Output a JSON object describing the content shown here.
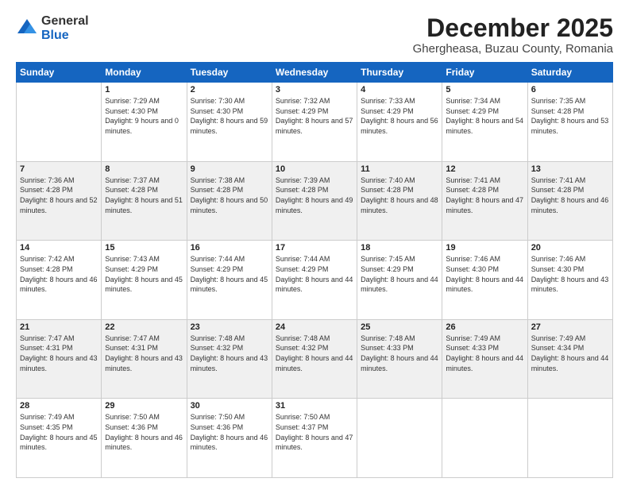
{
  "logo": {
    "general": "General",
    "blue": "Blue"
  },
  "title": "December 2025",
  "location": "Ghergheasa, Buzau County, Romania",
  "days_of_week": [
    "Sunday",
    "Monday",
    "Tuesday",
    "Wednesday",
    "Thursday",
    "Friday",
    "Saturday"
  ],
  "weeks": [
    [
      {
        "day": "",
        "sunrise": "",
        "sunset": "",
        "daylight": ""
      },
      {
        "day": "1",
        "sunrise": "Sunrise: 7:29 AM",
        "sunset": "Sunset: 4:30 PM",
        "daylight": "Daylight: 9 hours and 0 minutes."
      },
      {
        "day": "2",
        "sunrise": "Sunrise: 7:30 AM",
        "sunset": "Sunset: 4:30 PM",
        "daylight": "Daylight: 8 hours and 59 minutes."
      },
      {
        "day": "3",
        "sunrise": "Sunrise: 7:32 AM",
        "sunset": "Sunset: 4:29 PM",
        "daylight": "Daylight: 8 hours and 57 minutes."
      },
      {
        "day": "4",
        "sunrise": "Sunrise: 7:33 AM",
        "sunset": "Sunset: 4:29 PM",
        "daylight": "Daylight: 8 hours and 56 minutes."
      },
      {
        "day": "5",
        "sunrise": "Sunrise: 7:34 AM",
        "sunset": "Sunset: 4:29 PM",
        "daylight": "Daylight: 8 hours and 54 minutes."
      },
      {
        "day": "6",
        "sunrise": "Sunrise: 7:35 AM",
        "sunset": "Sunset: 4:28 PM",
        "daylight": "Daylight: 8 hours and 53 minutes."
      }
    ],
    [
      {
        "day": "7",
        "sunrise": "Sunrise: 7:36 AM",
        "sunset": "Sunset: 4:28 PM",
        "daylight": "Daylight: 8 hours and 52 minutes."
      },
      {
        "day": "8",
        "sunrise": "Sunrise: 7:37 AM",
        "sunset": "Sunset: 4:28 PM",
        "daylight": "Daylight: 8 hours and 51 minutes."
      },
      {
        "day": "9",
        "sunrise": "Sunrise: 7:38 AM",
        "sunset": "Sunset: 4:28 PM",
        "daylight": "Daylight: 8 hours and 50 minutes."
      },
      {
        "day": "10",
        "sunrise": "Sunrise: 7:39 AM",
        "sunset": "Sunset: 4:28 PM",
        "daylight": "Daylight: 8 hours and 49 minutes."
      },
      {
        "day": "11",
        "sunrise": "Sunrise: 7:40 AM",
        "sunset": "Sunset: 4:28 PM",
        "daylight": "Daylight: 8 hours and 48 minutes."
      },
      {
        "day": "12",
        "sunrise": "Sunrise: 7:41 AM",
        "sunset": "Sunset: 4:28 PM",
        "daylight": "Daylight: 8 hours and 47 minutes."
      },
      {
        "day": "13",
        "sunrise": "Sunrise: 7:41 AM",
        "sunset": "Sunset: 4:28 PM",
        "daylight": "Daylight: 8 hours and 46 minutes."
      }
    ],
    [
      {
        "day": "14",
        "sunrise": "Sunrise: 7:42 AM",
        "sunset": "Sunset: 4:28 PM",
        "daylight": "Daylight: 8 hours and 46 minutes."
      },
      {
        "day": "15",
        "sunrise": "Sunrise: 7:43 AM",
        "sunset": "Sunset: 4:29 PM",
        "daylight": "Daylight: 8 hours and 45 minutes."
      },
      {
        "day": "16",
        "sunrise": "Sunrise: 7:44 AM",
        "sunset": "Sunset: 4:29 PM",
        "daylight": "Daylight: 8 hours and 45 minutes."
      },
      {
        "day": "17",
        "sunrise": "Sunrise: 7:44 AM",
        "sunset": "Sunset: 4:29 PM",
        "daylight": "Daylight: 8 hours and 44 minutes."
      },
      {
        "day": "18",
        "sunrise": "Sunrise: 7:45 AM",
        "sunset": "Sunset: 4:29 PM",
        "daylight": "Daylight: 8 hours and 44 minutes."
      },
      {
        "day": "19",
        "sunrise": "Sunrise: 7:46 AM",
        "sunset": "Sunset: 4:30 PM",
        "daylight": "Daylight: 8 hours and 44 minutes."
      },
      {
        "day": "20",
        "sunrise": "Sunrise: 7:46 AM",
        "sunset": "Sunset: 4:30 PM",
        "daylight": "Daylight: 8 hours and 43 minutes."
      }
    ],
    [
      {
        "day": "21",
        "sunrise": "Sunrise: 7:47 AM",
        "sunset": "Sunset: 4:31 PM",
        "daylight": "Daylight: 8 hours and 43 minutes."
      },
      {
        "day": "22",
        "sunrise": "Sunrise: 7:47 AM",
        "sunset": "Sunset: 4:31 PM",
        "daylight": "Daylight: 8 hours and 43 minutes."
      },
      {
        "day": "23",
        "sunrise": "Sunrise: 7:48 AM",
        "sunset": "Sunset: 4:32 PM",
        "daylight": "Daylight: 8 hours and 43 minutes."
      },
      {
        "day": "24",
        "sunrise": "Sunrise: 7:48 AM",
        "sunset": "Sunset: 4:32 PM",
        "daylight": "Daylight: 8 hours and 44 minutes."
      },
      {
        "day": "25",
        "sunrise": "Sunrise: 7:48 AM",
        "sunset": "Sunset: 4:33 PM",
        "daylight": "Daylight: 8 hours and 44 minutes."
      },
      {
        "day": "26",
        "sunrise": "Sunrise: 7:49 AM",
        "sunset": "Sunset: 4:33 PM",
        "daylight": "Daylight: 8 hours and 44 minutes."
      },
      {
        "day": "27",
        "sunrise": "Sunrise: 7:49 AM",
        "sunset": "Sunset: 4:34 PM",
        "daylight": "Daylight: 8 hours and 44 minutes."
      }
    ],
    [
      {
        "day": "28",
        "sunrise": "Sunrise: 7:49 AM",
        "sunset": "Sunset: 4:35 PM",
        "daylight": "Daylight: 8 hours and 45 minutes."
      },
      {
        "day": "29",
        "sunrise": "Sunrise: 7:50 AM",
        "sunset": "Sunset: 4:36 PM",
        "daylight": "Daylight: 8 hours and 46 minutes."
      },
      {
        "day": "30",
        "sunrise": "Sunrise: 7:50 AM",
        "sunset": "Sunset: 4:36 PM",
        "daylight": "Daylight: 8 hours and 46 minutes."
      },
      {
        "day": "31",
        "sunrise": "Sunrise: 7:50 AM",
        "sunset": "Sunset: 4:37 PM",
        "daylight": "Daylight: 8 hours and 47 minutes."
      },
      {
        "day": "",
        "sunrise": "",
        "sunset": "",
        "daylight": ""
      },
      {
        "day": "",
        "sunrise": "",
        "sunset": "",
        "daylight": ""
      },
      {
        "day": "",
        "sunrise": "",
        "sunset": "",
        "daylight": ""
      }
    ]
  ]
}
